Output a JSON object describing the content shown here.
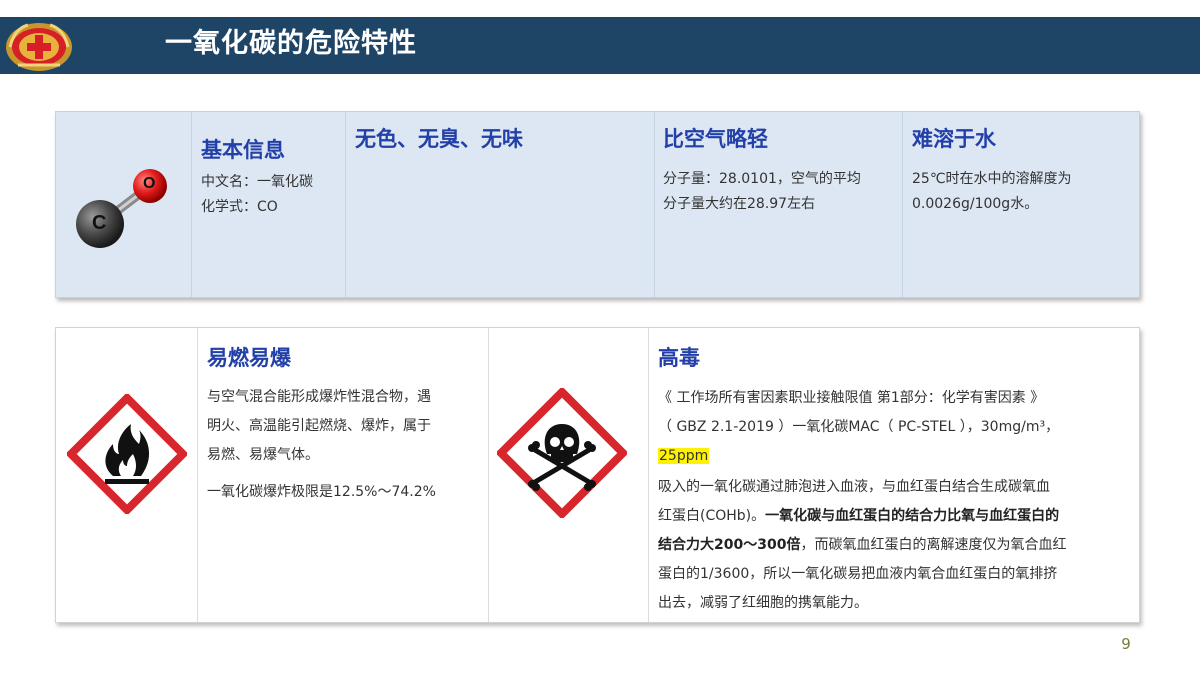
{
  "header": {
    "title": "一氧化碳的危险特性",
    "logo_icon": "emblem-logo-icon",
    "bar_color": "#1f4566"
  },
  "basic_info": {
    "molecule": {
      "atom_c": "C",
      "atom_o": "O"
    },
    "basic": {
      "title": "基本信息",
      "lines": [
        "中文名：一氧化碳",
        "化学式：CO"
      ]
    },
    "appearance": {
      "title": "无色、无臭、无味"
    },
    "density": {
      "title": "比空气略轻",
      "lines": [
        "分子量：28.0101，空气的平均",
        "分子量大约在28.97左右"
      ]
    },
    "solubility": {
      "title": "难溶于水",
      "lines": [
        "25℃时在水中的溶解度为",
        "0.0026g/100g水。"
      ]
    }
  },
  "hazards": {
    "flammable": {
      "icon": "flame-hazard-icon",
      "title": "易燃易爆",
      "lines": [
        "与空气混合能形成爆炸性混合物，遇",
        "明火、高温能引起燃烧、爆炸，属于",
        "易燃、易爆气体。"
      ],
      "limit": "一氧化碳爆炸极限是12.5%～74.2%"
    },
    "toxic": {
      "icon": "skull-crossbones-hazard-icon",
      "title": "高毒",
      "std_lines": [
        "《 工作场所有害因素职业接触限值 第1部分：化学有害因素 》",
        "（ GBZ 2.1-2019 ）一氧化碳MAC（ PC-STEL ），30mg/m³，"
      ],
      "std_highlight": "25ppm",
      "desc_line1": "吸入的一氧化碳通过肺泡进入血液，与血红蛋白结合生成碳氧血",
      "desc_line2_normal": "红蛋白(COHb)。",
      "desc_line2_bold": "一氧化碳与血红蛋白的结合力比氧与血红蛋白的",
      "desc_line3_bold": "结合力大200～300倍",
      "desc_line3_normal": "，而碳氧血红蛋白的离解速度仅为氧合血红",
      "desc_line4": "蛋白的1/3600，所以一氧化碳易把血液内氧合血红蛋白的氧排挤",
      "desc_line5": "出去，减弱了红细胞的携氧能力。"
    }
  },
  "page_number": "9",
  "colors": {
    "heading_blue": "#2340a8",
    "panel_fill": "#dde7f3",
    "hazard_red": "#d7262c",
    "highlight_yellow": "#fff200"
  }
}
